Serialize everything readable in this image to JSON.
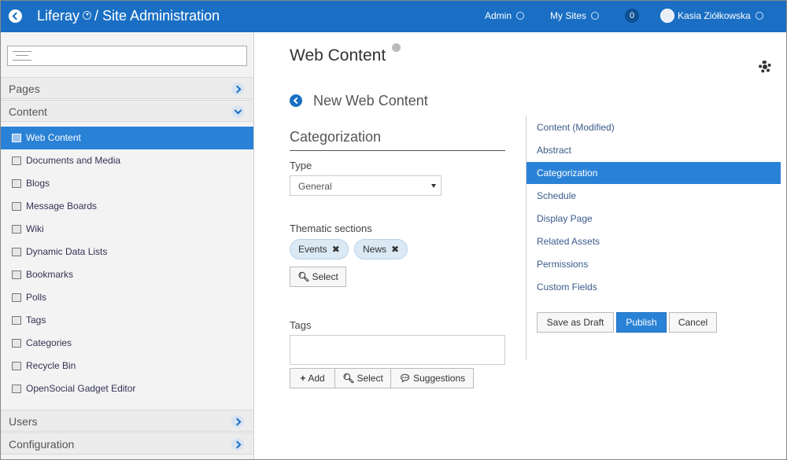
{
  "topbar": {
    "site_title": "Liferay",
    "site_suffix": "/ Site Administration",
    "admin_label": "Admin",
    "mysites_label": "My Sites",
    "notifications_count": "0",
    "user_name": "Kasia Ziółkowska"
  },
  "sidebar": {
    "panels": {
      "pages": "Pages",
      "content": "Content",
      "users": "Users",
      "configuration": "Configuration"
    },
    "items": [
      {
        "label": "Web Content",
        "icon": "web-content-icon"
      },
      {
        "label": "Documents and Media",
        "icon": "documents-icon"
      },
      {
        "label": "Blogs",
        "icon": "blogs-icon"
      },
      {
        "label": "Message Boards",
        "icon": "message-boards-icon"
      },
      {
        "label": "Wiki",
        "icon": "wiki-icon"
      },
      {
        "label": "Dynamic Data Lists",
        "icon": "data-lists-icon"
      },
      {
        "label": "Bookmarks",
        "icon": "bookmarks-icon"
      },
      {
        "label": "Polls",
        "icon": "polls-icon"
      },
      {
        "label": "Tags",
        "icon": "tags-icon"
      },
      {
        "label": "Categories",
        "icon": "categories-icon"
      },
      {
        "label": "Recycle Bin",
        "icon": "recycle-bin-icon"
      },
      {
        "label": "OpenSocial Gadget Editor",
        "icon": "gadget-editor-icon"
      }
    ]
  },
  "main": {
    "title": "Web Content",
    "subtitle": "New Web Content",
    "section_title": "Categorization",
    "type_label": "Type",
    "type_value": "General",
    "thematic_label": "Thematic sections",
    "chips": [
      "Events",
      "News"
    ],
    "select_label": "Select",
    "tags_label": "Tags",
    "add_label": "Add",
    "suggestions_label": "Suggestions"
  },
  "right_nav": {
    "items": [
      "Content (Modified)",
      "Abstract",
      "Categorization",
      "Schedule",
      "Display Page",
      "Related Assets",
      "Permissions",
      "Custom Fields"
    ],
    "active": "Categorization",
    "save_draft": "Save as Draft",
    "publish": "Publish",
    "cancel": "Cancel"
  },
  "colors": {
    "brand_blue": "#1a6fc4",
    "active_blue": "#2a82d7"
  }
}
